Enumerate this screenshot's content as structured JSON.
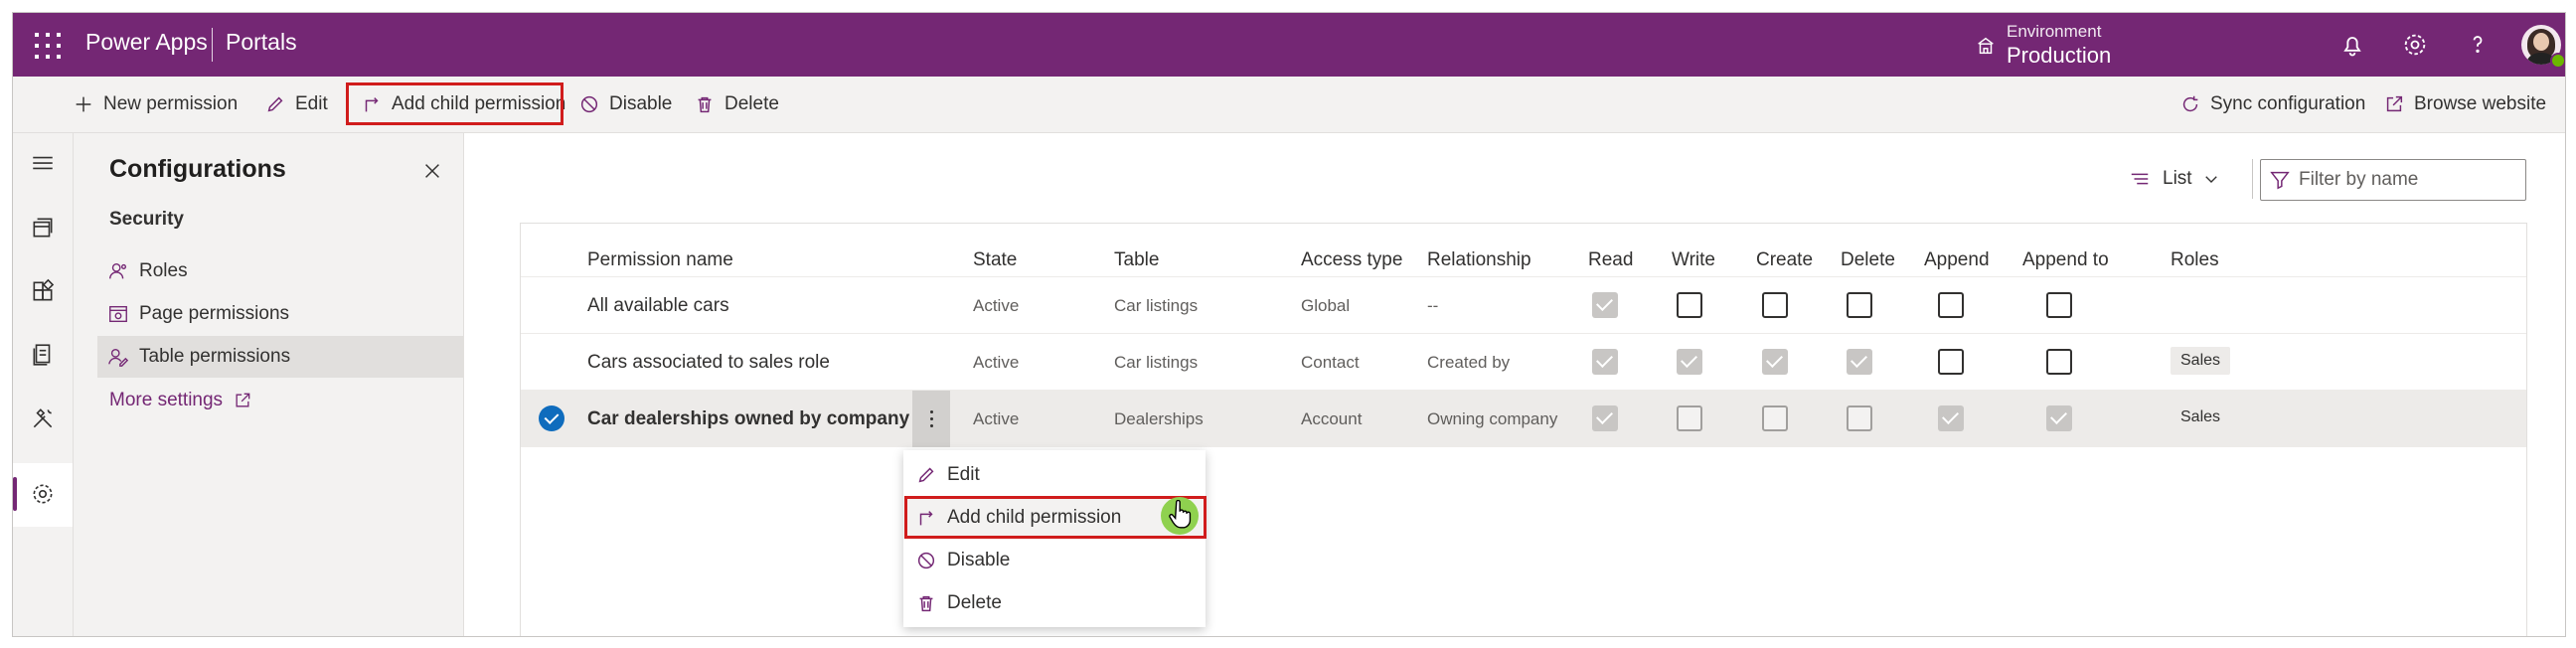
{
  "topbar": {
    "app_title": "Power Apps",
    "portal_title": "Portals",
    "environment_label": "Environment",
    "environment_value": "Production",
    "icons": [
      "waffle-icon",
      "environment-icon",
      "bell-icon",
      "gear-icon",
      "help-icon",
      "avatar"
    ],
    "accent_color": "#742774"
  },
  "commandbar": {
    "new_permission": "New permission",
    "edit": "Edit",
    "add_child_permission": "Add child permission",
    "disable": "Disable",
    "delete": "Delete",
    "sync_configuration": "Sync configuration",
    "browse_website": "Browse website"
  },
  "panel": {
    "title": "Configurations",
    "section": "Security",
    "items": [
      {
        "label": "Roles",
        "icon": "roles-icon"
      },
      {
        "label": "Page permissions",
        "icon": "page-permissions-icon"
      },
      {
        "label": "Table permissions",
        "icon": "table-permissions-icon",
        "selected": true
      }
    ],
    "more_settings": "More settings"
  },
  "toolbar": {
    "view": "List",
    "filter_placeholder": "Filter by name"
  },
  "grid": {
    "columns": [
      "Permission name",
      "State",
      "Table",
      "Access type",
      "Relationship",
      "Read",
      "Write",
      "Create",
      "Delete",
      "Append",
      "Append to",
      "Roles"
    ],
    "rows": [
      {
        "name": "All available cars",
        "state": "Active",
        "table": "Car listings",
        "access": "Global",
        "relationship": "--",
        "read": true,
        "write": false,
        "create": false,
        "delete": false,
        "append": false,
        "append_to": false,
        "roles": ""
      },
      {
        "name": "Cars associated to sales role",
        "state": "Active",
        "table": "Car listings",
        "access": "Contact",
        "relationship": "Created by",
        "read": true,
        "write": true,
        "create": true,
        "delete": true,
        "append": false,
        "append_to": false,
        "roles": "Sales"
      },
      {
        "name": "Car dealerships owned by company",
        "state": "Active",
        "table": "Dealerships",
        "access": "Account",
        "relationship": "Owning company",
        "read": true,
        "write": false,
        "create": false,
        "delete": false,
        "append": true,
        "append_to": true,
        "roles": "Sales",
        "selected": true
      }
    ]
  },
  "context_menu": {
    "items": [
      "Edit",
      "Add child permission",
      "Disable",
      "Delete"
    ],
    "highlighted": "Add child permission"
  },
  "colors": {
    "highlight_border": "#d01c1c",
    "selected_check": "#0f6cbd",
    "cursor_bubble": "#8fd14f"
  }
}
